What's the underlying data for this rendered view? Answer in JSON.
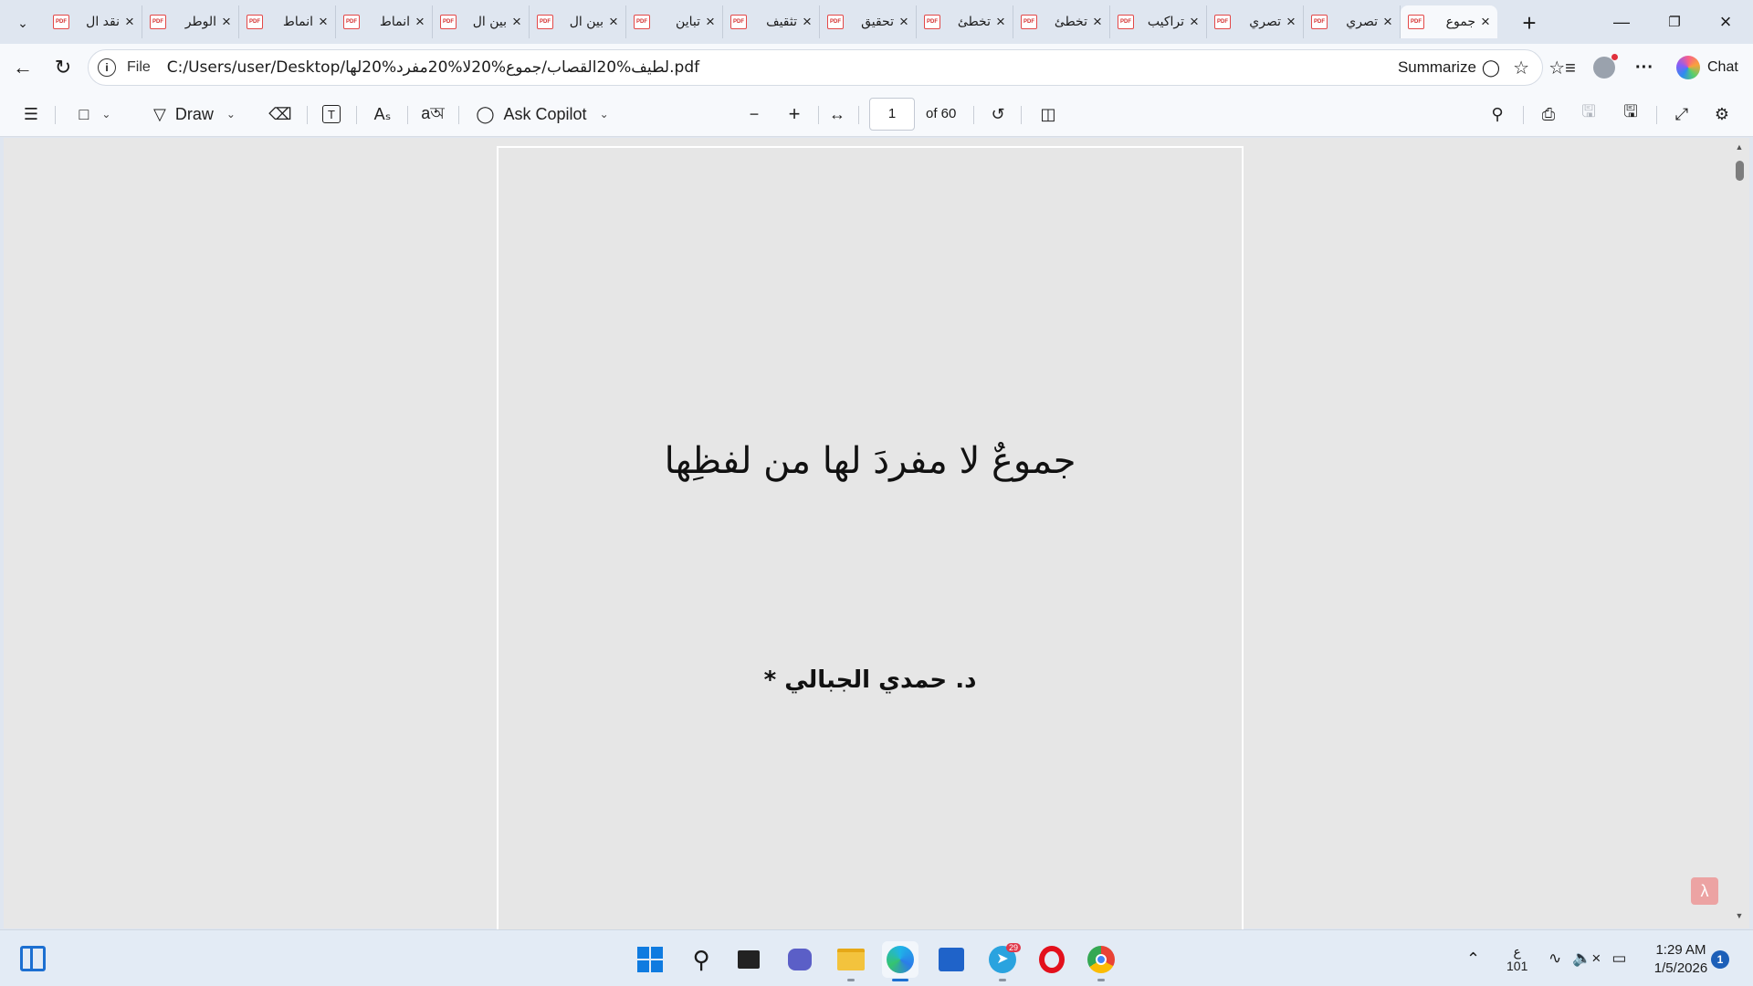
{
  "tabs": [
    {
      "title": "نقد ال"
    },
    {
      "title": "الوطر"
    },
    {
      "title": "انماط"
    },
    {
      "title": "انماط"
    },
    {
      "title": "بين ال"
    },
    {
      "title": "بين ال"
    },
    {
      "title": "تباين"
    },
    {
      "title": "تثقيف"
    },
    {
      "title": "تحقيق"
    },
    {
      "title": "تخطئ"
    },
    {
      "title": "تخطئ"
    },
    {
      "title": "تراكيب"
    },
    {
      "title": "تصري"
    },
    {
      "title": "تصري"
    },
    {
      "title": "جموع"
    }
  ],
  "pdf_icon_text": "PDF",
  "address": {
    "scheme": "File",
    "url": "C:/Users/user/Desktop/لطيف%20القصاب/جموع%20لا%20مفرد%20لها.pdf",
    "summarize": "Summarize"
  },
  "chat_label": "Chat",
  "toolbar": {
    "draw_label": "Draw",
    "ask_copilot_label": "Ask Copilot",
    "current_page": "1",
    "page_count": "of 60"
  },
  "document": {
    "title": "جموعٌ لا مفردَ لها من لفظِها",
    "author": "د. حمدي الجبالي *"
  },
  "tray": {
    "language_top": "ع",
    "language_bottom": "101",
    "time": "1:29 AM",
    "date": "1/5/2026",
    "notification_count": "1",
    "telegram_badge": "29"
  }
}
